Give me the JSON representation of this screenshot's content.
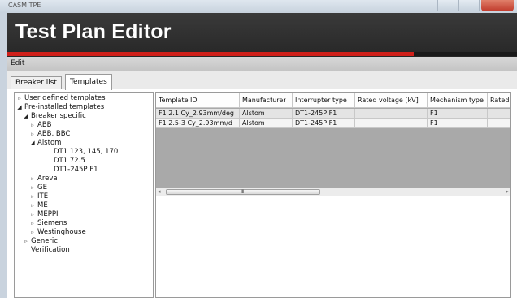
{
  "window": {
    "title": "CASM TPE"
  },
  "header": {
    "title": "Test Plan Editor"
  },
  "menu": {
    "items": [
      "Edit"
    ]
  },
  "tabs": [
    {
      "label": "Breaker list",
      "active": false
    },
    {
      "label": "Templates",
      "active": true
    }
  ],
  "tree": {
    "nodes": [
      {
        "label": "User defined templates",
        "level": 0,
        "state": "collapsed"
      },
      {
        "label": "Pre-installed templates",
        "level": 0,
        "state": "expanded"
      },
      {
        "label": "Breaker specific",
        "level": 1,
        "state": "expanded"
      },
      {
        "label": "ABB",
        "level": 2,
        "state": "collapsed"
      },
      {
        "label": "ABB, BBC",
        "level": 2,
        "state": "collapsed"
      },
      {
        "label": "Alstom",
        "level": 2,
        "state": "expanded"
      },
      {
        "label": "DT1 123, 145, 170",
        "level": 3,
        "state": "leaf"
      },
      {
        "label": "DT1 72.5",
        "level": 3,
        "state": "leaf"
      },
      {
        "label": "DT1-245P F1",
        "level": 3,
        "state": "leaf"
      },
      {
        "label": "Areva",
        "level": 2,
        "state": "collapsed"
      },
      {
        "label": "GE",
        "level": 2,
        "state": "collapsed"
      },
      {
        "label": "ITE",
        "level": 2,
        "state": "collapsed"
      },
      {
        "label": "ME",
        "level": 2,
        "state": "collapsed"
      },
      {
        "label": "MEPPI",
        "level": 2,
        "state": "collapsed"
      },
      {
        "label": "Siemens",
        "level": 2,
        "state": "collapsed"
      },
      {
        "label": "Westinghouse",
        "level": 2,
        "state": "collapsed"
      },
      {
        "label": "Generic",
        "level": 1,
        "state": "collapsed"
      },
      {
        "label": "Verification",
        "level": 1,
        "state": "leaf"
      }
    ]
  },
  "grid": {
    "columns": [
      "Template ID",
      "Manufacturer",
      "Interrupter type",
      "Rated voltage [kV]",
      "Mechanism type",
      "Rated"
    ],
    "rows": [
      [
        "F1 2.1 Cy_2.93mm/deg",
        "Alstom",
        "DT1-245P F1",
        "",
        "F1",
        ""
      ],
      [
        "F1 2.5-3 Cy_2.93mm/d",
        "Alstom",
        "DT1-245P F1",
        "",
        "F1",
        ""
      ]
    ],
    "scroll_grip": "III"
  },
  "colors": {
    "header_bg": "#2f2f2f",
    "accent_red": "#d0201a",
    "grid_empty": "#a9a9a9"
  }
}
